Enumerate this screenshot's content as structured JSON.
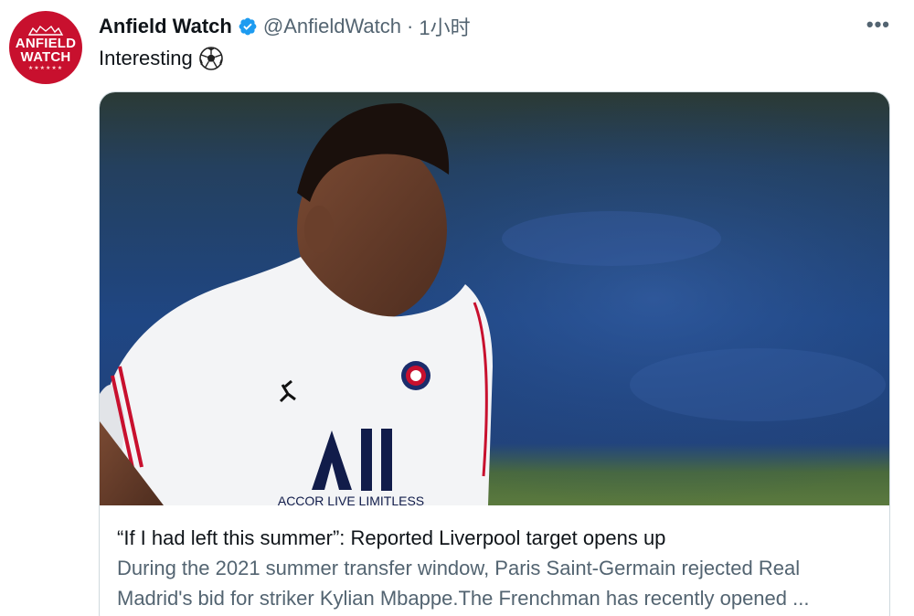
{
  "tweet": {
    "avatar": {
      "line1": "ANFIELD",
      "line2": "WATCH",
      "stars": "★★★★★★",
      "color": "#c8102e"
    },
    "author_name": "Anfield Watch",
    "verified_icon": "verified-badge-icon",
    "handle": "@AnfieldWatch",
    "separator": "·",
    "time": "1小时",
    "more_icon": "more-dots-icon",
    "more_glyph": "•••",
    "text": "Interesting",
    "emoji_icon": "soccer-ball-icon",
    "card": {
      "image_alt": "player-photo",
      "shirt_text": "All",
      "sponsor_text": "ACCOR LIVE LIMITLESS",
      "title": "“If I had left this summer”: Reported Liverpool target opens up",
      "description": "During the 2021 summer transfer window, Paris Saint-Germain rejected Real Madrid's bid for striker Kylian Mbappe.The Frenchman has recently opened ..."
    }
  },
  "colors": {
    "text_primary": "#0f1419",
    "text_secondary": "#536471",
    "verified": "#1d9bf0",
    "border": "#cfd9de"
  }
}
